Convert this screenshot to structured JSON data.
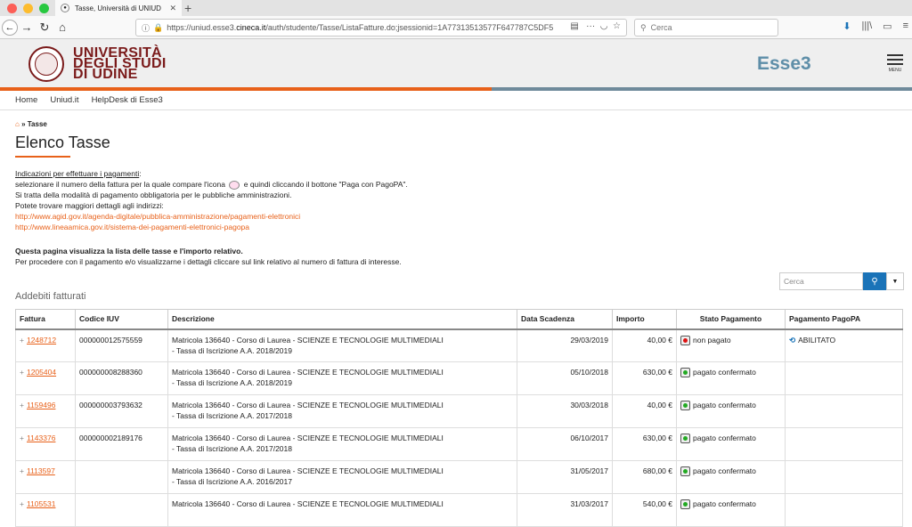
{
  "browser": {
    "tab_title": "Tasse, Università di UNIUD",
    "url_prefix": "https://uniud.esse3.",
    "url_domain": "cineca.it",
    "url_rest": "/auth/studente/Tasse/ListaFatture.do;jsessionid=1A77313513577F647787C5DF5",
    "search_placeholder": "Cerca"
  },
  "site": {
    "university_line1": "UNIVERSITÀ",
    "university_line2": "DEGLI STUDI",
    "university_line3": "DI UDINE",
    "brand": "Esse3",
    "menu_label": "MENU",
    "nav": [
      "Home",
      "Uniud.it",
      "HelpDesk di Esse3"
    ]
  },
  "page": {
    "breadcrumb_sep": "»",
    "breadcrumb": "Tasse",
    "title": "Elenco Tasse",
    "instr_heading": "Indicazioni per effettuare i pagamenti",
    "instr_line1a": "selezionare il numero della fattura per la quale compare l'icona",
    "instr_line1b": "e quindi cliccando il bottone \"Paga con PagoPA\".",
    "instr_line2": "Si tratta della modalità di pagamento obbligatoria per le pubbliche amministrazioni.",
    "instr_line3": "Potete trovare maggiori dettagli agli indirizzi:",
    "link1": "http://www.agid.gov.it/agenda-digitale/pubblica-amministrazione/pagamenti-elettronici",
    "link2": "http://www.lineaamica.gov.it/sistema-dei-pagamenti-elettronici-pagopa",
    "info_bold": "Questa pagina visualizza la lista delle tasse e l'importo relativo.",
    "info_line": "Per procedere con il pagamento e/o visualizzarne i dettagli cliccare sul link relativo al numero di fattura di interesse.",
    "table_search_placeholder": "Cerca",
    "section_title": "Addebiti fatturati"
  },
  "table": {
    "headers": [
      "Fattura",
      "Codice IUV",
      "Descrizione",
      "Data Scadenza",
      "Importo",
      "Stato Pagamento",
      "Pagamento PagoPA"
    ],
    "rows": [
      {
        "fattura": "1248712",
        "iuv": "000000012575559",
        "desc1": "Matricola 136640 - Corso di Laurea - SCIENZE E TECNOLOGIE MULTIMEDIALI",
        "desc2": "- Tassa di Iscrizione A.A. 2018/2019",
        "scadenza": "29/03/2019",
        "importo": "40,00 €",
        "stato": "non pagato",
        "stato_color": "#d11",
        "pagopa": "ABILITATO"
      },
      {
        "fattura": "1205404",
        "iuv": "000000008288360",
        "desc1": "Matricola 136640 - Corso di Laurea - SCIENZE E TECNOLOGIE MULTIMEDIALI",
        "desc2": "- Tassa di Iscrizione A.A. 2018/2019",
        "scadenza": "05/10/2018",
        "importo": "630,00 €",
        "stato": "pagato confermato",
        "stato_color": "#2a2",
        "pagopa": ""
      },
      {
        "fattura": "1159496",
        "iuv": "000000003793632",
        "desc1": "Matricola 136640 - Corso di Laurea - SCIENZE E TECNOLOGIE MULTIMEDIALI",
        "desc2": "- Tassa di Iscrizione A.A. 2017/2018",
        "scadenza": "30/03/2018",
        "importo": "40,00 €",
        "stato": "pagato confermato",
        "stato_color": "#2a2",
        "pagopa": ""
      },
      {
        "fattura": "1143376",
        "iuv": "000000002189176",
        "desc1": "Matricola 136640 - Corso di Laurea - SCIENZE E TECNOLOGIE MULTIMEDIALI",
        "desc2": "- Tassa di Iscrizione A.A. 2017/2018",
        "scadenza": "06/10/2017",
        "importo": "630,00 €",
        "stato": "pagato confermato",
        "stato_color": "#2a2",
        "pagopa": ""
      },
      {
        "fattura": "1113597",
        "iuv": "",
        "desc1": "Matricola 136640 - Corso di Laurea - SCIENZE E TECNOLOGIE MULTIMEDIALI",
        "desc2": "- Tassa di Iscrizione A.A. 2016/2017",
        "scadenza": "31/05/2017",
        "importo": "680,00 €",
        "stato": "pagato confermato",
        "stato_color": "#2a2",
        "pagopa": ""
      },
      {
        "fattura": "1105531",
        "iuv": "",
        "desc1": "Matricola 136640 - Corso di Laurea - SCIENZE E TECNOLOGIE MULTIMEDIALI",
        "desc2": "",
        "scadenza": "31/03/2017",
        "importo": "540,00 €",
        "stato": "pagato confermato",
        "stato_color": "#2a2",
        "pagopa": ""
      }
    ]
  }
}
